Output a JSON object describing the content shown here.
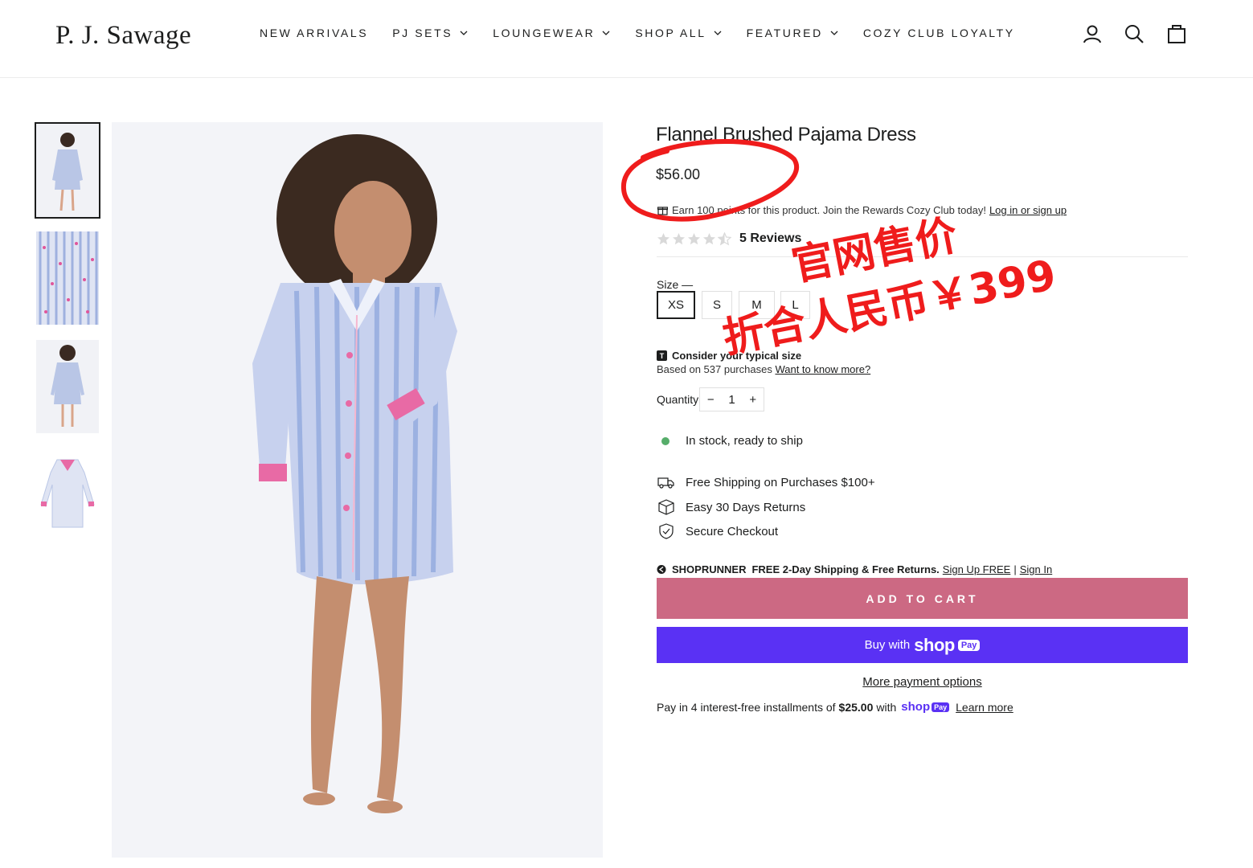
{
  "header": {
    "logo": "P. J. Sawage",
    "nav": [
      {
        "label": "NEW ARRIVALS",
        "dropdown": false
      },
      {
        "label": "PJ SETS",
        "dropdown": true
      },
      {
        "label": "LOUNGEWEAR",
        "dropdown": true
      },
      {
        "label": "SHOP ALL",
        "dropdown": true
      },
      {
        "label": "FEATURED",
        "dropdown": true
      },
      {
        "label": "COZY CLUB LOYALTY",
        "dropdown": false
      }
    ],
    "icons": [
      "account-icon",
      "search-icon",
      "cart-icon"
    ]
  },
  "gallery": {
    "thumbnails": [
      "front-view",
      "fabric-detail",
      "back-view",
      "flat-lay"
    ],
    "selected_index": 0
  },
  "product": {
    "title": "Flannel Brushed Pajama Dress",
    "price": "$56.00",
    "rewards_text": "Earn 100 points for this product. Join the Rewards Cozy Club today!",
    "rewards_link": "Log in or sign up",
    "rating": 4.5,
    "reviews_label": "5 Reviews",
    "size_label": "Size",
    "sizes": [
      "XS",
      "S",
      "M",
      "L"
    ],
    "selected_size": "XS",
    "fit_title": "Consider your typical size",
    "fit_badge": "T",
    "fit_sub": "Based on 537 purchases",
    "fit_link": "Want to know more?",
    "quantity_label": "Quantity",
    "quantity": "1",
    "qty_minus": "−",
    "qty_plus": "+",
    "stock": "In stock, ready to ship",
    "perks": [
      "Free Shipping on Purchases $100+",
      "Easy 30 Days Returns",
      "Secure Checkout"
    ],
    "shoprunner_brand": "SHOPRUNNER",
    "shoprunner_text": "FREE 2-Day Shipping & Free Returns.",
    "shoprunner_signup": "Sign Up FREE",
    "shoprunner_sep": "|",
    "shoprunner_signin": "Sign In",
    "add_to_cart": "ADD TO CART",
    "buy_with": "Buy with",
    "buy_shop": "shop",
    "buy_pay": "Pay",
    "more_payment": "More payment options",
    "install_pre": "Pay in 4 interest-free installments of",
    "install_amount": "$25.00",
    "install_with": "with",
    "install_shop": "shop",
    "install_pay": "Pay",
    "install_link": "Learn more"
  },
  "annotation": {
    "line1": "官网售价",
    "line2": "折合人民币￥399",
    "color": "#ef1c1c"
  },
  "colors": {
    "add_to_cart": "#cc6983",
    "shop_pay": "#5a31f4",
    "in_stock": "#56ad6a"
  }
}
